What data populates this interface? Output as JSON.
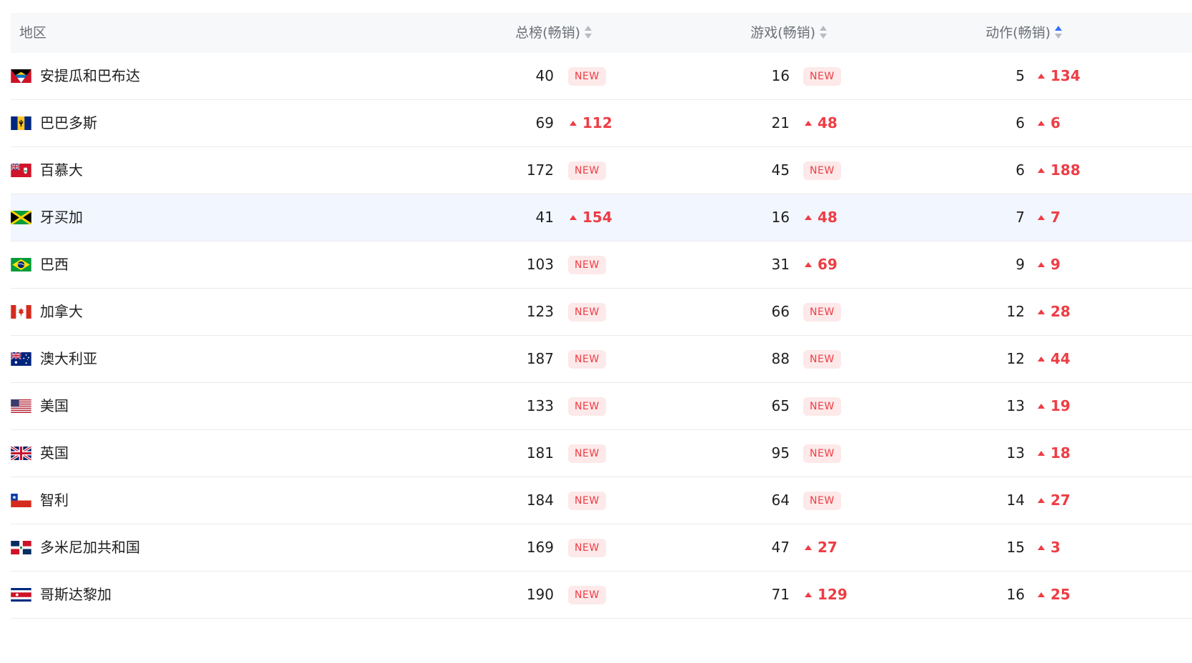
{
  "header": {
    "region": "地区",
    "total": "总榜(畅销)",
    "game": "游戏(畅销)",
    "action": "动作(畅销)"
  },
  "new_label": "NEW",
  "rows": [
    {
      "region": "安提瓜和巴布达",
      "flag": "antigua-flag",
      "total": "40",
      "total_change": "NEW",
      "game": "16",
      "game_change": "NEW",
      "action": "5",
      "action_change": "134"
    },
    {
      "region": "巴巴多斯",
      "flag": "barbados-flag",
      "total": "69",
      "total_change": "112",
      "game": "21",
      "game_change": "48",
      "action": "6",
      "action_change": "6"
    },
    {
      "region": "百慕大",
      "flag": "bermuda-flag",
      "total": "172",
      "total_change": "NEW",
      "game": "45",
      "game_change": "NEW",
      "action": "6",
      "action_change": "188"
    },
    {
      "region": "牙买加",
      "flag": "jamaica-flag",
      "total": "41",
      "total_change": "154",
      "game": "16",
      "game_change": "48",
      "action": "7",
      "action_change": "7"
    },
    {
      "region": "巴西",
      "flag": "brazil-flag",
      "total": "103",
      "total_change": "NEW",
      "game": "31",
      "game_change": "69",
      "action": "9",
      "action_change": "9"
    },
    {
      "region": "加拿大",
      "flag": "canada-flag",
      "total": "123",
      "total_change": "NEW",
      "game": "66",
      "game_change": "NEW",
      "action": "12",
      "action_change": "28"
    },
    {
      "region": "澳大利亚",
      "flag": "australia-flag",
      "total": "187",
      "total_change": "NEW",
      "game": "88",
      "game_change": "NEW",
      "action": "12",
      "action_change": "44"
    },
    {
      "region": "美国",
      "flag": "usa-flag",
      "total": "133",
      "total_change": "NEW",
      "game": "65",
      "game_change": "NEW",
      "action": "13",
      "action_change": "19"
    },
    {
      "region": "英国",
      "flag": "uk-flag",
      "total": "181",
      "total_change": "NEW",
      "game": "95",
      "game_change": "NEW",
      "action": "13",
      "action_change": "18"
    },
    {
      "region": "智利",
      "flag": "chile-flag",
      "total": "184",
      "total_change": "NEW",
      "game": "64",
      "game_change": "NEW",
      "action": "14",
      "action_change": "27"
    },
    {
      "region": "多米尼加共和国",
      "flag": "dominican-flag",
      "total": "169",
      "total_change": "NEW",
      "game": "47",
      "game_change": "27",
      "action": "15",
      "action_change": "3"
    },
    {
      "region": "哥斯达黎加",
      "flag": "costarica-flag",
      "total": "190",
      "total_change": "NEW",
      "game": "71",
      "game_change": "129",
      "action": "16",
      "action_change": "25"
    }
  ],
  "colors": {
    "accent_red": "#ee3d45",
    "sort_active": "#3370ff",
    "header_bg": "#f7f8fa",
    "highlight_row": "#f2f6fe"
  }
}
